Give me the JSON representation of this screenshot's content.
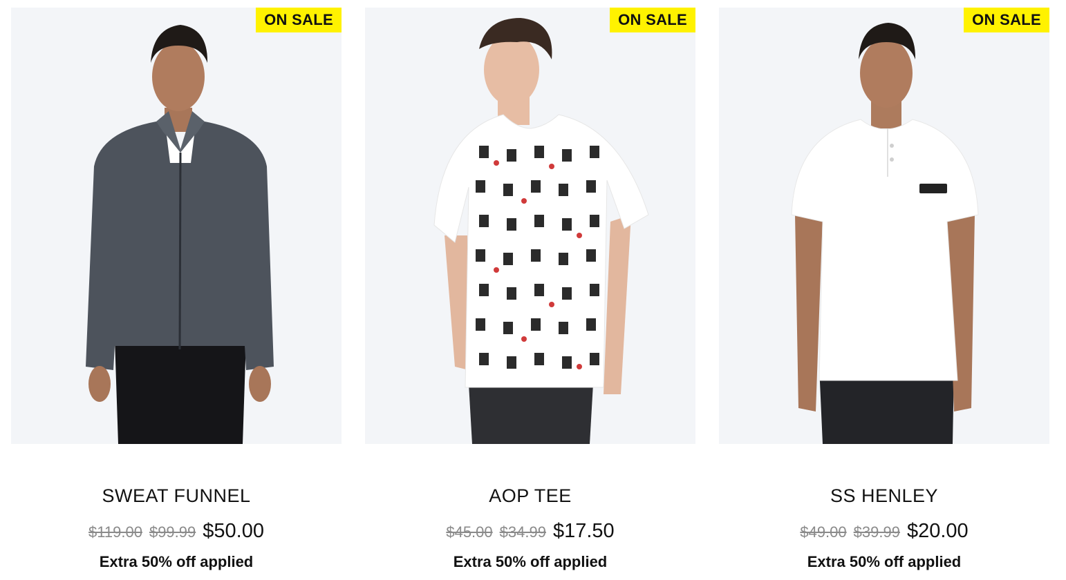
{
  "products": [
    {
      "badge": "ON SALE",
      "name": "SWEAT FUNNEL",
      "prices": {
        "original": "$119.00",
        "was": "$99.99",
        "current": "$50.00"
      },
      "promo": "Extra 50% off applied",
      "colors": {
        "top": "#4d535c",
        "undershirt": "#ffffff",
        "pants": "#151518"
      }
    },
    {
      "badge": "ON SALE",
      "name": "AOP TEE",
      "prices": {
        "original": "$45.00",
        "was": "$34.99",
        "current": "$17.50"
      },
      "promo": "Extra 50% off applied",
      "colors": {
        "top": "#ffffff",
        "pattern": "#2b2b2b",
        "accent": "#d03a3a",
        "pants": "#2e2f33"
      }
    },
    {
      "badge": "ON SALE",
      "name": "SS HENLEY",
      "prices": {
        "original": "$49.00",
        "was": "$39.99",
        "current": "$20.00"
      },
      "promo": "Extra 50% off applied",
      "colors": {
        "top": "#ffffff",
        "pants": "#232428"
      }
    }
  ],
  "theme": {
    "badge_bg": "#fff200",
    "image_bg": "#f3f5f8",
    "muted_price": "#8a8a8a"
  }
}
